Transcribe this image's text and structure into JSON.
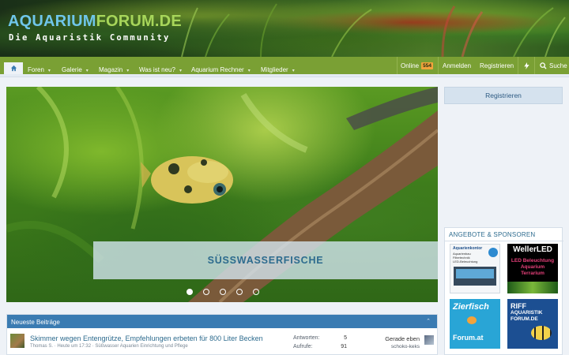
{
  "logo": {
    "part1": "AQUARIUM",
    "part2": "FORUM.DE",
    "tagline": "Die Aquaristik Community"
  },
  "nav": {
    "home_icon": "home-icon",
    "items": [
      {
        "label": "Foren",
        "caret": "▾"
      },
      {
        "label": "Galerie",
        "caret": "▾"
      },
      {
        "label": "Magazin",
        "caret": "▾"
      },
      {
        "label": "Was ist neu?",
        "caret": "▾"
      },
      {
        "label": "Aquarium Rechner",
        "caret": "▾"
      },
      {
        "label": "Mitglieder",
        "caret": "▾"
      }
    ],
    "online_label": "Online",
    "online_count": "554",
    "login": "Anmelden",
    "register": "Registrieren",
    "flash_icon": "bolt-icon",
    "search_icon": "search-icon",
    "search": "Suche"
  },
  "slider": {
    "caption": "SÜSSWASSERFISCHE",
    "dots": 5,
    "active_dot": 1
  },
  "sidebar": {
    "register": "Registrieren",
    "ads_title": "Angebote & Sponsoren",
    "ads": [
      {
        "title": "Aquarienkontor",
        "lines": [
          "Aquarienbau",
          "Filtertechnik",
          "LED-Beleuchtung"
        ]
      },
      {
        "title": "WellerLED",
        "lines": [
          "LED Beleuchtung",
          "Aquarium",
          "Terrarium"
        ]
      },
      {
        "title": "Zierfisch",
        "lines": [
          "Forum.at"
        ]
      },
      {
        "title": "RIFF",
        "lines": [
          "AQUARISTIK",
          "FORUM.DE"
        ]
      }
    ]
  },
  "latest": {
    "title": "Neueste Beiträge",
    "toggle": "⌃",
    "posts": [
      {
        "title": "Skimmer wegen Entengrütze, Empfehlungen erbeten für 800 Liter Becken",
        "meta": "Thomas S. · Heute um 17:32 · Süßwasser Aquarien Einrichtung und Pflege",
        "replies_label": "Antworten:",
        "replies": "5",
        "views_label": "Aufrufe:",
        "views": "91",
        "last_time": "Gerade eben",
        "last_user": "schoko-keks"
      }
    ]
  },
  "colors": {
    "nav": "#7aa034",
    "accent": "#2d6b8e",
    "section_head": "#3a7bb2",
    "badge": "#f2a33b"
  }
}
